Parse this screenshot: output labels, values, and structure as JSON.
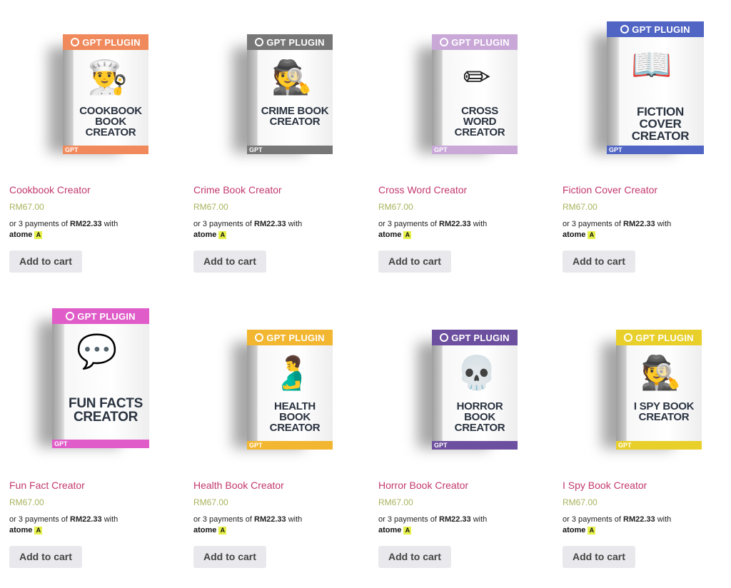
{
  "products": [
    {
      "name": "Cookbook Creator",
      "price": "RM67.00",
      "box_brand": "GPT PLUGIN",
      "box_title": "COOKBOOK BOOK CREATOR",
      "box_corner": "GPT",
      "accent": "#f08a5d",
      "art_icon": "chef-icon",
      "art_glyph": "👨‍🍳"
    },
    {
      "name": "Crime Book Creator",
      "price": "RM67.00",
      "box_brand": "GPT PLUGIN",
      "box_title": "CRIME BOOK CREATOR",
      "box_corner": "GPT",
      "accent": "#777777",
      "art_icon": "crime-scene-icon",
      "art_glyph": "🕵"
    },
    {
      "name": "Cross Word Creator",
      "price": "RM67.00",
      "box_brand": "GPT PLUGIN",
      "box_title": "CROSS WORD CREATOR",
      "box_corner": "GPT",
      "accent": "#c9a8d8",
      "art_icon": "crossword-pencil-icon",
      "art_glyph": "✏"
    },
    {
      "name": "Fiction Cover Creator",
      "price": "RM67.00",
      "box_brand": "GPT PLUGIN",
      "box_title": "FICTION COVER CREATOR",
      "box_corner": "GPT",
      "accent": "#5166c4",
      "art_icon": "open-book-icon",
      "art_glyph": "📖"
    },
    {
      "name": "Fun Fact Creator",
      "price": "RM67.00",
      "box_brand": "GPT PLUGIN",
      "box_title": "FUN FACTS CREATOR",
      "box_corner": "GPT",
      "accent": "#e05cc8",
      "art_icon": "did-you-know-icon",
      "art_glyph": "💬"
    },
    {
      "name": "Health Book Creator",
      "price": "RM67.00",
      "box_brand": "GPT PLUGIN",
      "box_title": "HEALTH BOOK CREATOR",
      "box_corner": "GPT",
      "accent": "#f2b630",
      "art_icon": "stomach-icon",
      "art_glyph": "🫃"
    },
    {
      "name": "Horror Book Creator",
      "price": "RM67.00",
      "box_brand": "GPT PLUGIN",
      "box_title": "HORROR BOOK CREATOR",
      "box_corner": "GPT",
      "accent": "#6c4f9e",
      "art_icon": "skull-icon",
      "art_glyph": "💀"
    },
    {
      "name": "I Spy Book Creator",
      "price": "RM67.00",
      "box_brand": "GPT PLUGIN",
      "box_title": "I SPY BOOK CREATOR",
      "box_corner": "GPT",
      "accent": "#e8cf2a",
      "art_icon": "detective-icon",
      "art_glyph": "🕵"
    }
  ],
  "installment_prefix": "or 3 payments of ",
  "installment_amount": "RM22.33",
  "installment_suffix": " with",
  "payment_provider": "atome",
  "payment_icon_glyph": "A",
  "add_to_cart_label": "Add to cart"
}
